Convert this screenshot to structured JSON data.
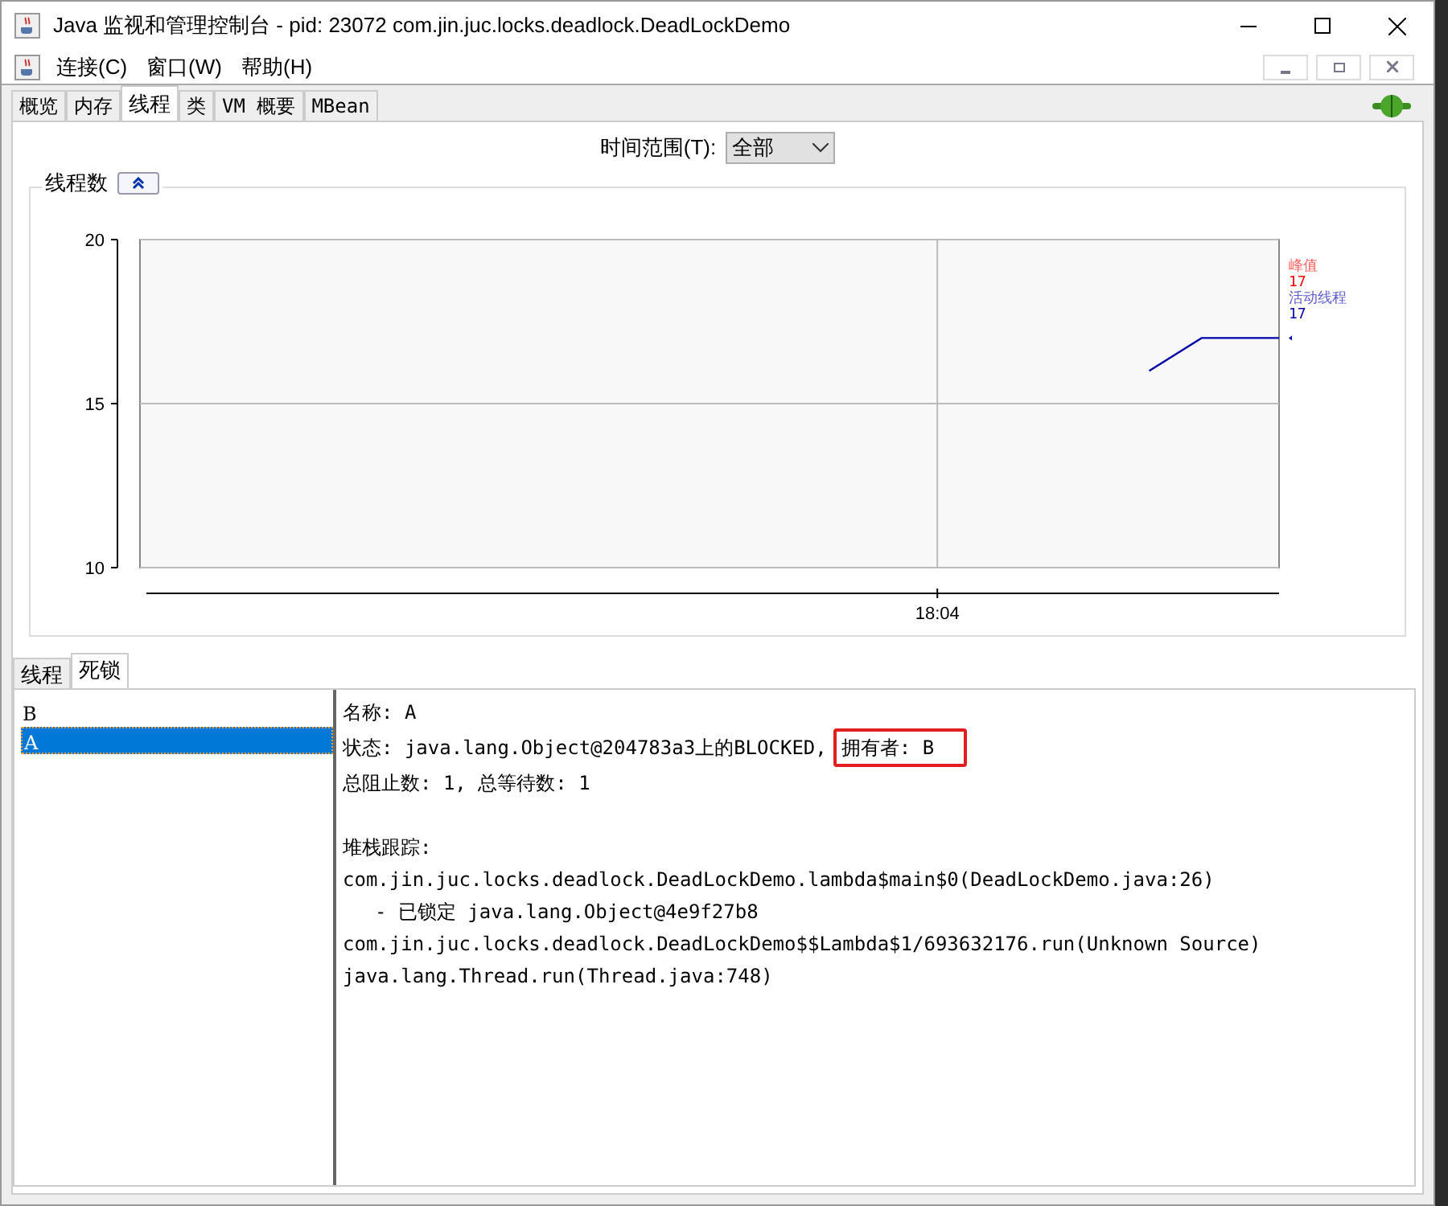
{
  "window": {
    "title": "Java 监视和管理控制台 - pid: 23072 com.jin.juc.locks.deadlock.DeadLockDemo"
  },
  "menu": [
    "连接(C)",
    "窗口(W)",
    "帮助(H)"
  ],
  "tabs": [
    {
      "label": "概览",
      "selected": false
    },
    {
      "label": "内存",
      "selected": false
    },
    {
      "label": "线程",
      "selected": true
    },
    {
      "label": "类",
      "selected": false
    },
    {
      "label": "VM 概要",
      "selected": false
    },
    {
      "label": "MBean",
      "selected": false
    }
  ],
  "time_range": {
    "label": "时间范围(T):",
    "value": "全部"
  },
  "thread_chart": {
    "title": "线程数",
    "peak": {
      "name": "峰值",
      "value": "17",
      "color": "#ff0000"
    },
    "active": {
      "name": "活动线程",
      "value": "17",
      "color": "#0000aa"
    },
    "y_labels": [
      "20",
      "15",
      "10"
    ],
    "time_label": "18:04"
  },
  "sub_tabs": [
    {
      "label": "线程",
      "selected": false
    },
    {
      "label": "死锁",
      "selected": true
    }
  ],
  "threads": [
    {
      "name": "B",
      "selected": false
    },
    {
      "name": "A",
      "selected": true
    }
  ],
  "details": {
    "name_line": "名称: A",
    "status": "状态: java.lang.Object@204783a3上的BLOCKED,",
    "owner": {
      "text": "拥有者: B",
      "highlighted": true
    },
    "counts": "总阻止数: 1, 总等待数: 1",
    "stack_title": "堆栈跟踪:",
    "stack": [
      {
        "text": "com.jin.juc.locks.deadlock.DeadLockDemo.lambda$main$0(DeadLockDemo.java:26)",
        "kind": "frame"
      },
      {
        "text": "- 已锁定 java.lang.Object@4e9f27b8",
        "kind": "lock"
      },
      {
        "text": "com.jin.juc.locks.deadlock.DeadLockDemo$$Lambda$1/693632176.run(Unknown Source)",
        "kind": "frame"
      },
      {
        "text": "java.lang.Thread.run(Thread.java:748)",
        "kind": "frame"
      }
    ]
  }
}
